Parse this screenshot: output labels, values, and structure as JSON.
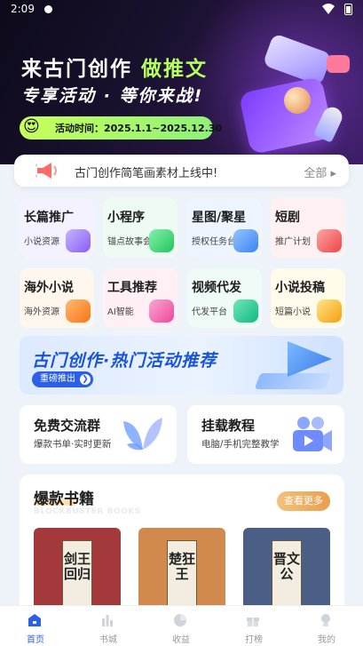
{
  "status_bar": {
    "time": "2:09"
  },
  "banner": {
    "title_main": "来古门创作",
    "title_accent": "做推文",
    "subtitle": "专享活动 · 等你来战!",
    "date_text": "活动时间：2025.1.1~2025.12.30",
    "colors": {
      "accent": "#b6ff5e",
      "bg": "#17102b"
    }
  },
  "notice": {
    "icon": "megaphone-icon",
    "text": "古门创作简笔画素材上线中!",
    "more_label": "全部"
  },
  "grid": [
    {
      "title": "长篇推广",
      "sub": "小说资源",
      "bg": "#f4f2ff",
      "icon_color": "#a78bfa",
      "icon": "book-icon"
    },
    {
      "title": "小程序",
      "sub": "锚点故事会",
      "bg": "#eefbf2",
      "icon_color": "#4ade80",
      "icon": "mini-program-icon"
    },
    {
      "title": "星图/聚星",
      "sub": "授权任务台",
      "bg": "#eef5ff",
      "icon_color": "#60a5fa",
      "icon": "star-icon"
    },
    {
      "title": "短剧",
      "sub": "推广计划",
      "bg": "#fff1f1",
      "icon_color": "#f87171",
      "icon": "film-icon"
    },
    {
      "title": "海外小说",
      "sub": "海外资源",
      "bg": "#fff6ee",
      "icon_color": "#fb923c",
      "icon": "globe-icon"
    },
    {
      "title": "工具推荐",
      "sub": "AI智能",
      "bg": "#fff0f6",
      "icon_color": "#f472b6",
      "icon": "tool-icon"
    },
    {
      "title": "视频代发",
      "sub": "代发平台",
      "bg": "#eefbf6",
      "icon_color": "#34d399",
      "icon": "video-icon"
    },
    {
      "title": "小说投稿",
      "sub": "短篇小说",
      "bg": "#fffbea",
      "icon_color": "#facc15",
      "icon": "submit-icon"
    }
  ],
  "promo": {
    "title": "古门创作·热门活动推荐",
    "button_label": "重磅推出"
  },
  "community": {
    "title": "免费交流群",
    "sub": "爆款书单·实时更新"
  },
  "tutorial": {
    "title": "挂载教程",
    "sub": "电脑/手机完整教学"
  },
  "books": {
    "title": "爆款书籍",
    "subtitle_en": "BLOCKBUSTER BOOKS",
    "more_label": "查看更多",
    "items": [
      {
        "title": "剑王回归",
        "bg": "#a3393a"
      },
      {
        "title": "楚狂王",
        "bg": "#d2894e"
      },
      {
        "title": "晋文公",
        "bg": "#4b5f86"
      }
    ]
  },
  "tabbar": {
    "items": [
      {
        "label": "首页",
        "icon": "home-icon"
      },
      {
        "label": "书城",
        "icon": "bookstore-icon"
      },
      {
        "label": "收益",
        "icon": "earnings-icon"
      },
      {
        "label": "打榜",
        "icon": "gift-icon"
      },
      {
        "label": "我的",
        "icon": "profile-icon"
      }
    ],
    "active_color": "#2a5fe6"
  }
}
